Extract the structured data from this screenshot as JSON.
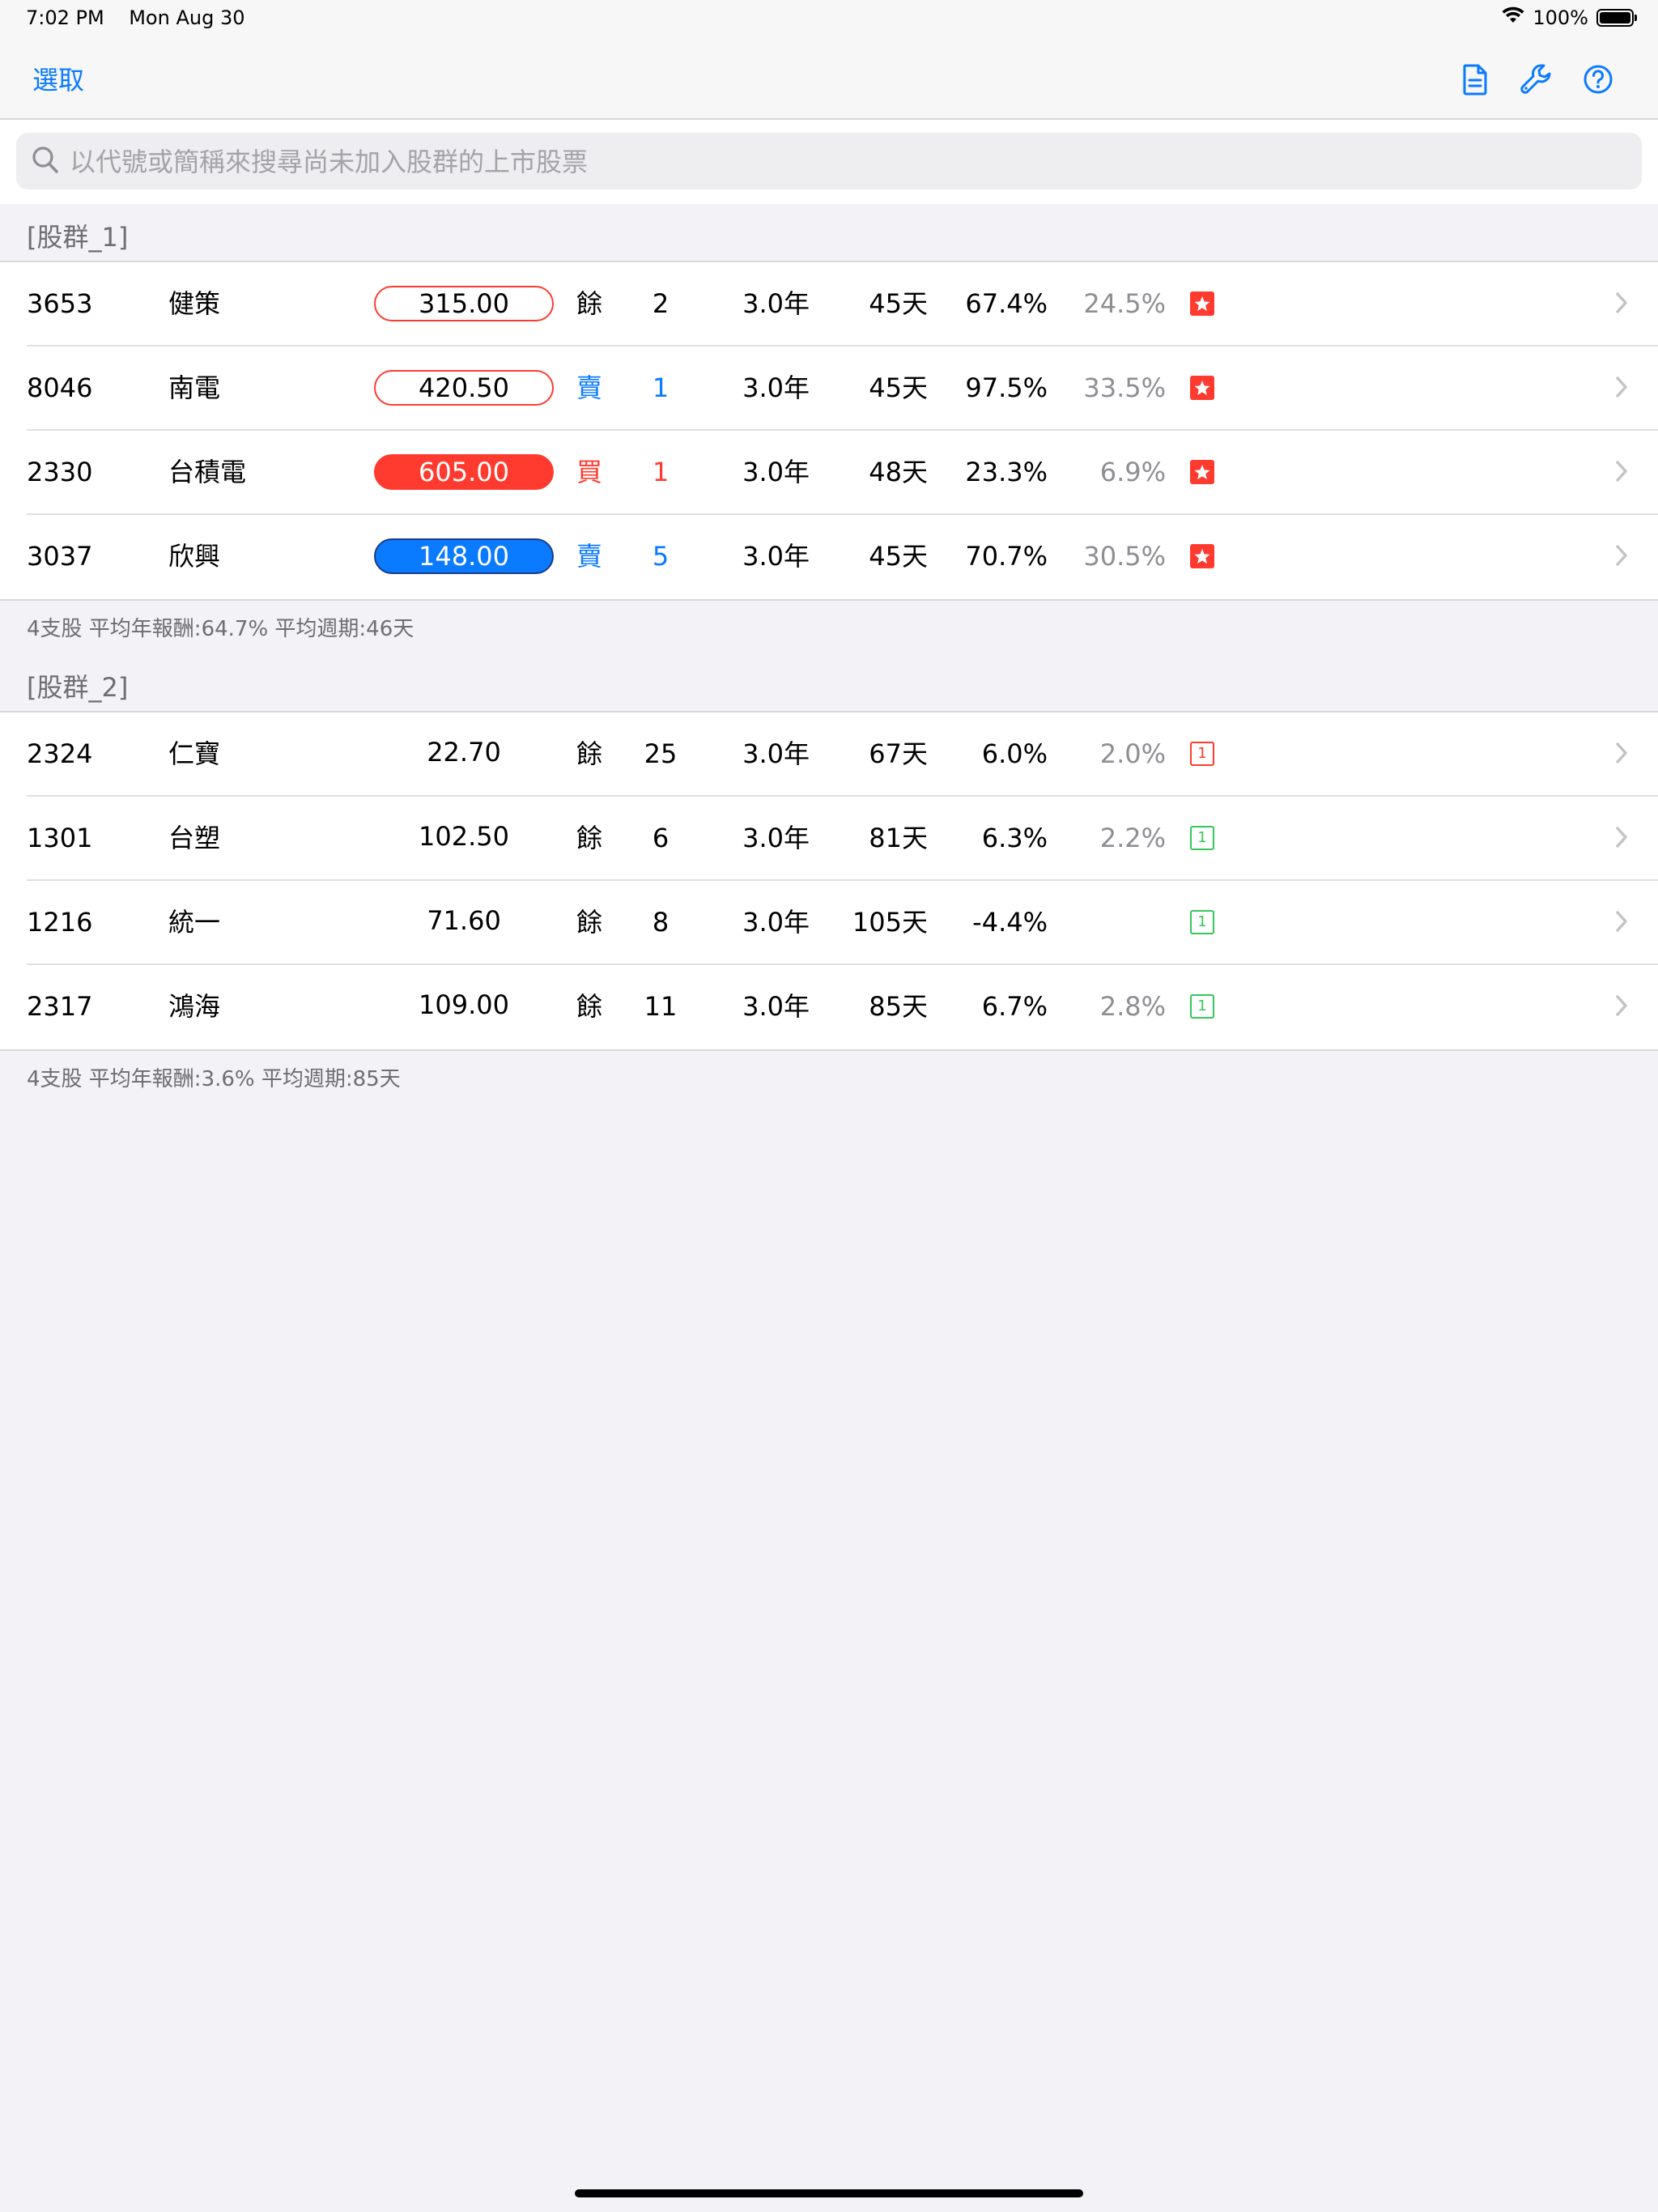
{
  "status_bar": {
    "time": "7:02 PM",
    "date": "Mon Aug 30",
    "battery_text": "100%",
    "battery_level": 1.0
  },
  "nav": {
    "select_label": "選取",
    "icons": [
      "document-icon",
      "wrench-icon",
      "help-icon"
    ]
  },
  "search": {
    "placeholder": "以代號或簡稱來搜尋尚未加入股群的上市股票",
    "value": ""
  },
  "colors": {
    "accent": "#0a7aff",
    "red": "#ff3b30",
    "green": "#34c759",
    "secondary_text": "#8e8e93"
  },
  "groups": [
    {
      "title": "[股群_1]",
      "rows": [
        {
          "code": "3653",
          "name": "健策",
          "price": "315.00",
          "price_style": "outline",
          "action": "餘",
          "action_color": "black",
          "qty": "2",
          "years": "3.0年",
          "days": "45天",
          "ret": "67.4%",
          "ret2": "24.5%",
          "badge": "star"
        },
        {
          "code": "8046",
          "name": "南電",
          "price": "420.50",
          "price_style": "outline",
          "action": "賣",
          "action_color": "blue",
          "qty": "1",
          "years": "3.0年",
          "days": "45天",
          "ret": "97.5%",
          "ret2": "33.5%",
          "badge": "star"
        },
        {
          "code": "2330",
          "name": "台積電",
          "price": "605.00",
          "price_style": "red",
          "action": "買",
          "action_color": "red",
          "qty": "1",
          "years": "3.0年",
          "days": "48天",
          "ret": "23.3%",
          "ret2": "6.9%",
          "badge": "star"
        },
        {
          "code": "3037",
          "name": "欣興",
          "price": "148.00",
          "price_style": "blue",
          "action": "賣",
          "action_color": "blue",
          "qty": "5",
          "years": "3.0年",
          "days": "45天",
          "ret": "70.7%",
          "ret2": "30.5%",
          "badge": "star"
        }
      ],
      "footer": "4支股   平均年報酬:64.7%   平均週期:46天"
    },
    {
      "title": "[股群_2]",
      "rows": [
        {
          "code": "2324",
          "name": "仁寶",
          "price": "22.70",
          "price_style": "plain",
          "action": "餘",
          "action_color": "black",
          "qty": "25",
          "years": "3.0年",
          "days": "67天",
          "ret": "6.0%",
          "ret2": "2.0%",
          "badge": "box-red",
          "badge_text": "1"
        },
        {
          "code": "1301",
          "name": "台塑",
          "price": "102.50",
          "price_style": "plain",
          "action": "餘",
          "action_color": "black",
          "qty": "6",
          "years": "3.0年",
          "days": "81天",
          "ret": "6.3%",
          "ret2": "2.2%",
          "badge": "box-green",
          "badge_text": "1"
        },
        {
          "code": "1216",
          "name": "統一",
          "price": "71.60",
          "price_style": "plain",
          "action": "餘",
          "action_color": "black",
          "qty": "8",
          "years": "3.0年",
          "days": "105天",
          "ret": "-4.4%",
          "ret2": "",
          "badge": "box-green",
          "badge_text": "1"
        },
        {
          "code": "2317",
          "name": "鴻海",
          "price": "109.00",
          "price_style": "plain",
          "action": "餘",
          "action_color": "black",
          "qty": "11",
          "years": "3.0年",
          "days": "85天",
          "ret": "6.7%",
          "ret2": "2.8%",
          "badge": "box-green",
          "badge_text": "1"
        }
      ],
      "footer": "4支股   平均年報酬:3.6%   平均週期:85天"
    }
  ]
}
